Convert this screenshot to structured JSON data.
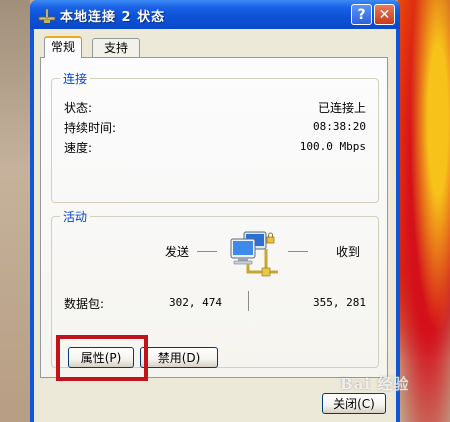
{
  "window": {
    "title": "本地连接 2 状态",
    "help_label": "?",
    "close_label": "✕"
  },
  "tabs": [
    {
      "label": "常规",
      "active": true
    },
    {
      "label": "支持",
      "active": false
    }
  ],
  "connection": {
    "legend": "连接",
    "rows": [
      {
        "label": "状态:",
        "value": "已连接上"
      },
      {
        "label": "持续时间:",
        "value": "08:38:20"
      },
      {
        "label": "速度:",
        "value": "100.0 Mbps"
      }
    ]
  },
  "activity": {
    "legend": "活动",
    "sent_label": "发送",
    "received_label": "收到",
    "packets_label": "数据包:",
    "packets_sent": "302, 474",
    "packets_received": "355, 281"
  },
  "buttons": {
    "properties": "属性(P)",
    "disable": "禁用(D)",
    "close": "关闭(C)"
  },
  "watermark": "Bai 经验",
  "colors": {
    "titlebar": "#0d53d8",
    "group_legend": "#0046d5",
    "highlight": "#c0131c",
    "tab_accent": "#f0a91f"
  }
}
